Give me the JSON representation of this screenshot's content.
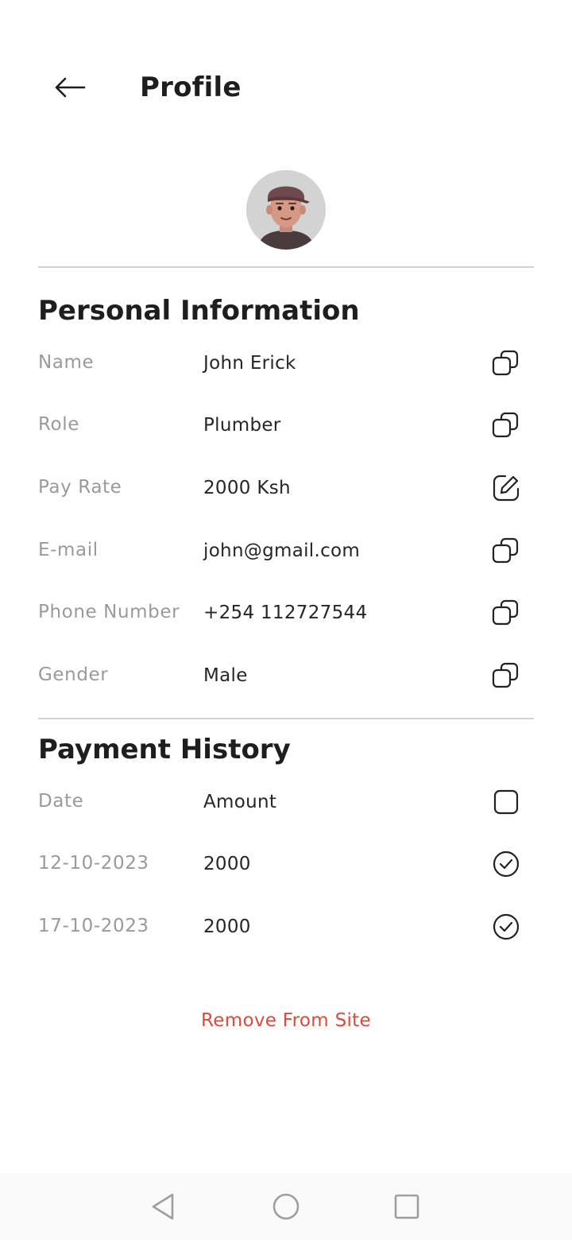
{
  "header": {
    "title": "Profile"
  },
  "personal": {
    "title": "Personal Information",
    "rows": [
      {
        "label": "Name",
        "value": "John Erick",
        "icon": "copy-icon"
      },
      {
        "label": "Role",
        "value": "Plumber",
        "icon": "copy-icon"
      },
      {
        "label": "Pay Rate",
        "value": "2000 Ksh",
        "icon": "edit-icon"
      },
      {
        "label": "E-mail",
        "value": "john@gmail.com",
        "icon": "copy-icon"
      },
      {
        "label": "Phone Number",
        "value": "+254 112727544",
        "icon": "copy-icon"
      },
      {
        "label": "Gender",
        "value": "Male",
        "icon": "copy-icon"
      }
    ]
  },
  "payments": {
    "title": "Payment History",
    "columns": {
      "date": "Date",
      "amount": "Amount",
      "icon": "checkbox-empty-icon"
    },
    "rows": [
      {
        "date": "12-10-2023",
        "amount": "2000",
        "icon": "check-circle-icon"
      },
      {
        "date": "17-10-2023",
        "amount": "2000",
        "icon": "check-circle-icon"
      }
    ]
  },
  "actions": {
    "remove_label": "Remove From Site"
  },
  "colors": {
    "danger": "#dc4a3c",
    "label": "#9a9a9a",
    "text": "#1e1e1e",
    "divider": "#d4d4d4"
  }
}
